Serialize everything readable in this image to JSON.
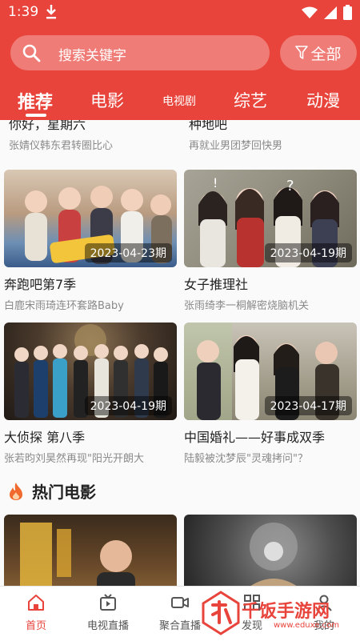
{
  "status_bar": {
    "time": "1:39"
  },
  "search": {
    "placeholder": "搜索关键字",
    "all_label": "全部"
  },
  "tabs": [
    {
      "label": "推荐"
    },
    {
      "label": "电影"
    },
    {
      "label": "电视剧"
    },
    {
      "label": "综艺"
    },
    {
      "label": "动漫"
    }
  ],
  "colors": {
    "accent": "#e8443b"
  },
  "top_items": [
    {
      "title": "你好，星期六",
      "subtitle": "张婧仪韩东君转圈比心"
    },
    {
      "title": "种地吧",
      "subtitle": "再就业男团梦回快男"
    }
  ],
  "shows": [
    {
      "title": "奔跑吧第7季",
      "subtitle": "白鹿宋雨琦连环套路Baby",
      "date": "2023-04-23期"
    },
    {
      "title": "女子推理社",
      "subtitle": "张雨绮李一桐解密烧脑机关",
      "date": "2023-04-19期"
    },
    {
      "title": "大侦探 第八季",
      "subtitle": "张若昀刘昊然再现\"阳光开朗大",
      "date": "2023-04-19期"
    },
    {
      "title": "中国婚礼——好事成双季",
      "subtitle": "陆毅被沈梦辰\"灵魂拷问\"？",
      "date": "2023-04-17期"
    }
  ],
  "section": {
    "hot_movies": "热门电影"
  },
  "bottom_nav": [
    {
      "label": "首页",
      "icon": "home-icon"
    },
    {
      "label": "电视直播",
      "icon": "tv-icon"
    },
    {
      "label": "聚合直播",
      "icon": "camera-icon"
    },
    {
      "label": "发现",
      "icon": "discover-icon"
    },
    {
      "label": "我的",
      "icon": "user-icon"
    }
  ],
  "watermark": {
    "text": "千饭手游网",
    "url_text": "www.eduxe.com"
  }
}
